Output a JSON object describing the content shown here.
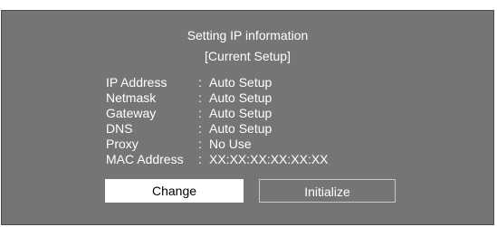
{
  "dialog": {
    "title": "Setting IP information",
    "subtitle": "[Current Setup]",
    "rows": [
      {
        "label": "IP Address",
        "sep": ":",
        "value": "Auto Setup"
      },
      {
        "label": "Netmask",
        "sep": ":",
        "value": "Auto Setup"
      },
      {
        "label": "Gateway",
        "sep": ":",
        "value": "Auto Setup"
      },
      {
        "label": "DNS",
        "sep": ":",
        "value": "Auto Setup"
      },
      {
        "label": "Proxy",
        "sep": ":",
        "value": "No Use"
      },
      {
        "label": "MAC Address",
        "sep": ":",
        "value": "XX:XX:XX:XX:XX:XX"
      }
    ],
    "buttons": {
      "change": "Change",
      "initialize": "Initialize"
    }
  },
  "colors": {
    "dialog_bg": "#757575",
    "text": "#ffffff",
    "selected_button_bg": "#ffffff",
    "button_border": "#c8c8c8"
  }
}
